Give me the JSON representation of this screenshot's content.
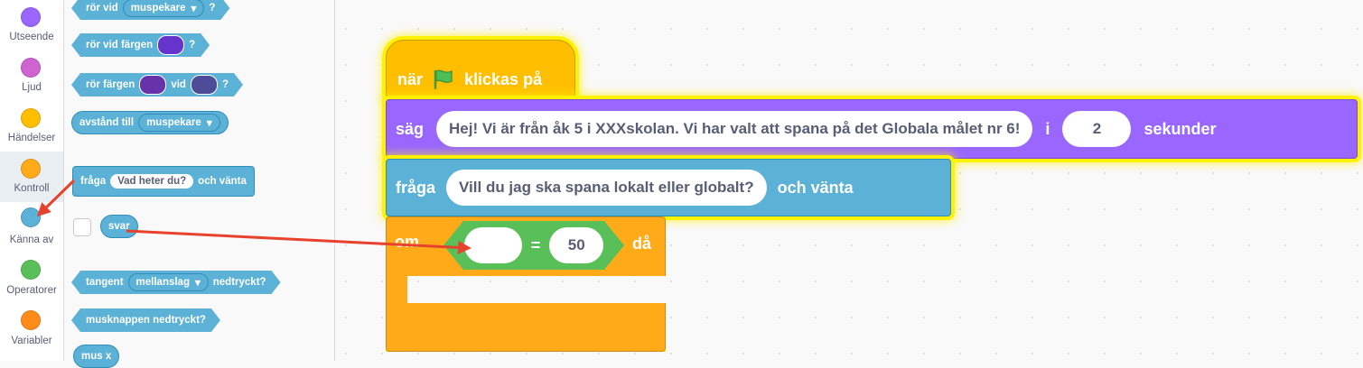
{
  "categories": [
    {
      "label": "Utseende",
      "color": "#9966ff"
    },
    {
      "label": "Ljud",
      "color": "#cf63cf"
    },
    {
      "label": "Händelser",
      "color": "#ffbf00"
    },
    {
      "label": "Kontroll",
      "color": "#ffab19"
    },
    {
      "label": "Känna av",
      "color": "#5cb1d6"
    },
    {
      "label": "Operatorer",
      "color": "#59c059"
    },
    {
      "label": "Variabler",
      "color": "#ff8c1a"
    }
  ],
  "palette": {
    "touching": {
      "text": "rör vid",
      "dropdown": "muspekare",
      "suffix": "?"
    },
    "touching_color": {
      "text": "rör vid färgen",
      "suffix": "?",
      "color": "#6633cc"
    },
    "color_touching": {
      "text1": "rör färgen",
      "text2": "vid",
      "suffix": "?",
      "color1": "#6633aa",
      "color2": "#4c4c99"
    },
    "distance": {
      "text": "avstånd till",
      "dropdown": "muspekare"
    },
    "ask": {
      "text1": "fråga",
      "input": "Vad heter du?",
      "text2": "och vänta"
    },
    "answer": {
      "text": "svar"
    },
    "key_pressed": {
      "text1": "tangent",
      "dropdown": "mellanslag",
      "text2": "nedtryckt?"
    },
    "mouse_down": {
      "text": "musknappen nedtryckt?"
    },
    "mouse_x": {
      "text": "mus x"
    }
  },
  "script": {
    "hat": {
      "text1": "när",
      "text2": "klickas på",
      "flag_color": "#4cbf56"
    },
    "say": {
      "text1": "säg",
      "message": "Hej! Vi är från åk 5 i XXXskolan. Vi har valt att spana på det Globala målet nr 6!",
      "text2": "i",
      "seconds": "2",
      "text3": "sekunder"
    },
    "ask": {
      "text1": "fråga",
      "question": "Vill du jag ska spana lokalt eller globalt?",
      "text2": "och vänta"
    },
    "if": {
      "text1": "om",
      "text2": "då"
    },
    "equals": {
      "left": "",
      "operator": "=",
      "right": "50"
    }
  },
  "colors": {
    "events": "#ffbf00",
    "looks": "#9966ff",
    "sensing": "#5cb1d6",
    "control": "#ffab19",
    "operators": "#59c059",
    "highlight": "#fff200",
    "arrow": "#e8412c"
  }
}
